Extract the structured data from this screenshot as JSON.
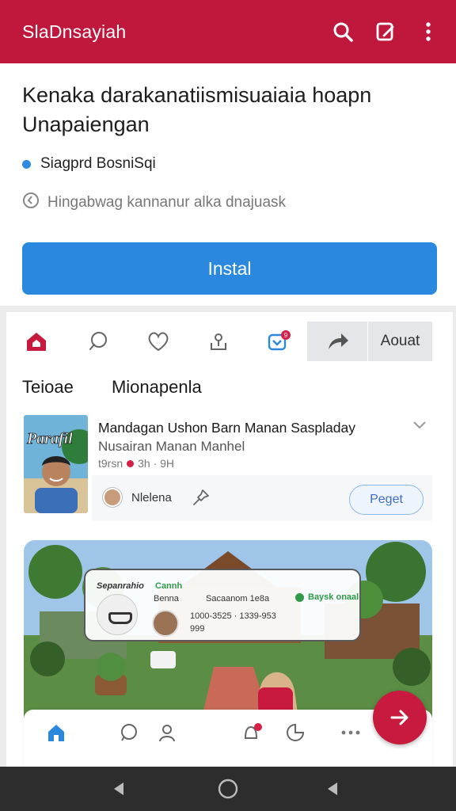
{
  "app": {
    "title": "SlaDnsayiah"
  },
  "article": {
    "headline_line1": "Kenaka darakanatiismisuaiaia hoapn",
    "headline_line2": "Unapaiengan",
    "source": "Siagprd BosniSqi",
    "meta": "Hingabwag kannanur alka dnajuask",
    "install_label": "Instal"
  },
  "actions": {
    "aouat_label": "Aouat",
    "notification_count": "9"
  },
  "tabs": [
    "Teioae",
    "Mionapenla"
  ],
  "post": {
    "title": "Mandagan Ushon Barn Manan Saspladay",
    "subtitle": "Nusairan Manan Manhel",
    "time_left": "t9rsn",
    "time_right": "3h · 9H",
    "user": "Nlelena",
    "follow_label": "Peget",
    "thumb_text": "Parafil"
  },
  "overlay": {
    "title": "Sepanrahio",
    "line_a": "Cannh",
    "line_b": "Benna",
    "line_c": "Sacaanom 1e8a",
    "line_d": "1000-3525 · 1339-953",
    "line_e": "999",
    "status": "Baysk onaal"
  },
  "colors": {
    "brand": "#c0183c",
    "primary": "#2a89df"
  }
}
